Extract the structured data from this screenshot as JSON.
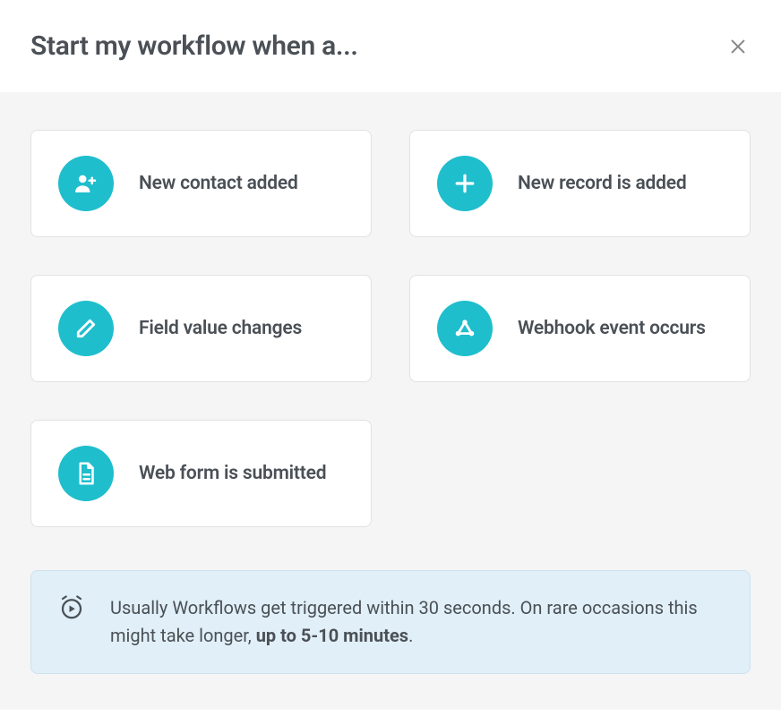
{
  "header": {
    "title": "Start my workflow when a..."
  },
  "triggers": [
    {
      "label": "New contact added",
      "icon": "person-add-icon"
    },
    {
      "label": "New record is added",
      "icon": "plus-icon"
    },
    {
      "label": "Field value changes",
      "icon": "pencil-icon"
    },
    {
      "label": "Webhook event occurs",
      "icon": "webhook-icon"
    },
    {
      "label": "Web form is submitted",
      "icon": "document-icon"
    }
  ],
  "info": {
    "text_before_bold": "Usually Workflows get triggered within 30 seconds. On rare occasions this might take longer, ",
    "bold": "up to 5-10 minutes",
    "text_after_bold": "."
  }
}
